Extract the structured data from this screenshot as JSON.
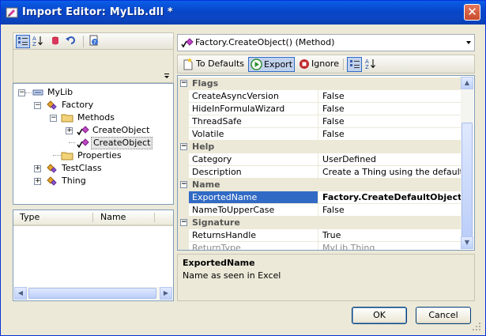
{
  "window": {
    "title": "Import Editor: MyLib.dll *",
    "close_glyph": "✕"
  },
  "tree": {
    "nodes": [
      {
        "label": "MyLib",
        "expander": "−"
      },
      {
        "label": "Factory",
        "expander": "−"
      },
      {
        "label": "Methods",
        "expander": "−"
      },
      {
        "label": "CreateObject",
        "expander": "+"
      },
      {
        "label": "CreateObject",
        "expander": ""
      },
      {
        "label": "Properties",
        "expander": ""
      },
      {
        "label": "TestClass",
        "expander": "+"
      },
      {
        "label": "Thing",
        "expander": "+"
      }
    ]
  },
  "listview": {
    "columns": [
      "Type",
      "Name"
    ]
  },
  "combo": {
    "value": "Factory.CreateObject() (Method)"
  },
  "toolbar": {
    "to_defaults": "To Defaults",
    "export": "Export",
    "ignore": "Ignore"
  },
  "grid": {
    "categories": [
      "Flags",
      "Help",
      "Name",
      "Signature"
    ],
    "rows": [
      {
        "name": "CreateAsyncVersion",
        "value": "False"
      },
      {
        "name": "HideInFormulaWizard",
        "value": "False"
      },
      {
        "name": "ThreadSafe",
        "value": "False"
      },
      {
        "name": "Volatile",
        "value": "False"
      },
      {
        "name": "Category",
        "value": "UserDefined"
      },
      {
        "name": "Description",
        "value": "Create a Thing using the default key."
      },
      {
        "name": "ExportedName",
        "value": "Factory.CreateDefaultObject"
      },
      {
        "name": "NameToUpperCase",
        "value": "False"
      },
      {
        "name": "ReturnsHandle",
        "value": "True"
      },
      {
        "name": "ReturnType",
        "value": "MyLib.Thing"
      }
    ]
  },
  "description": {
    "title": "ExportedName",
    "text": "Name as seen in Excel"
  },
  "buttons": {
    "ok": "OK",
    "cancel": "Cancel"
  },
  "colors": {
    "selection": "#316ac5",
    "titlebar": "#0a5ee8",
    "export_icon": "#2f8f2f",
    "ignore_icon": "#c0282d"
  }
}
